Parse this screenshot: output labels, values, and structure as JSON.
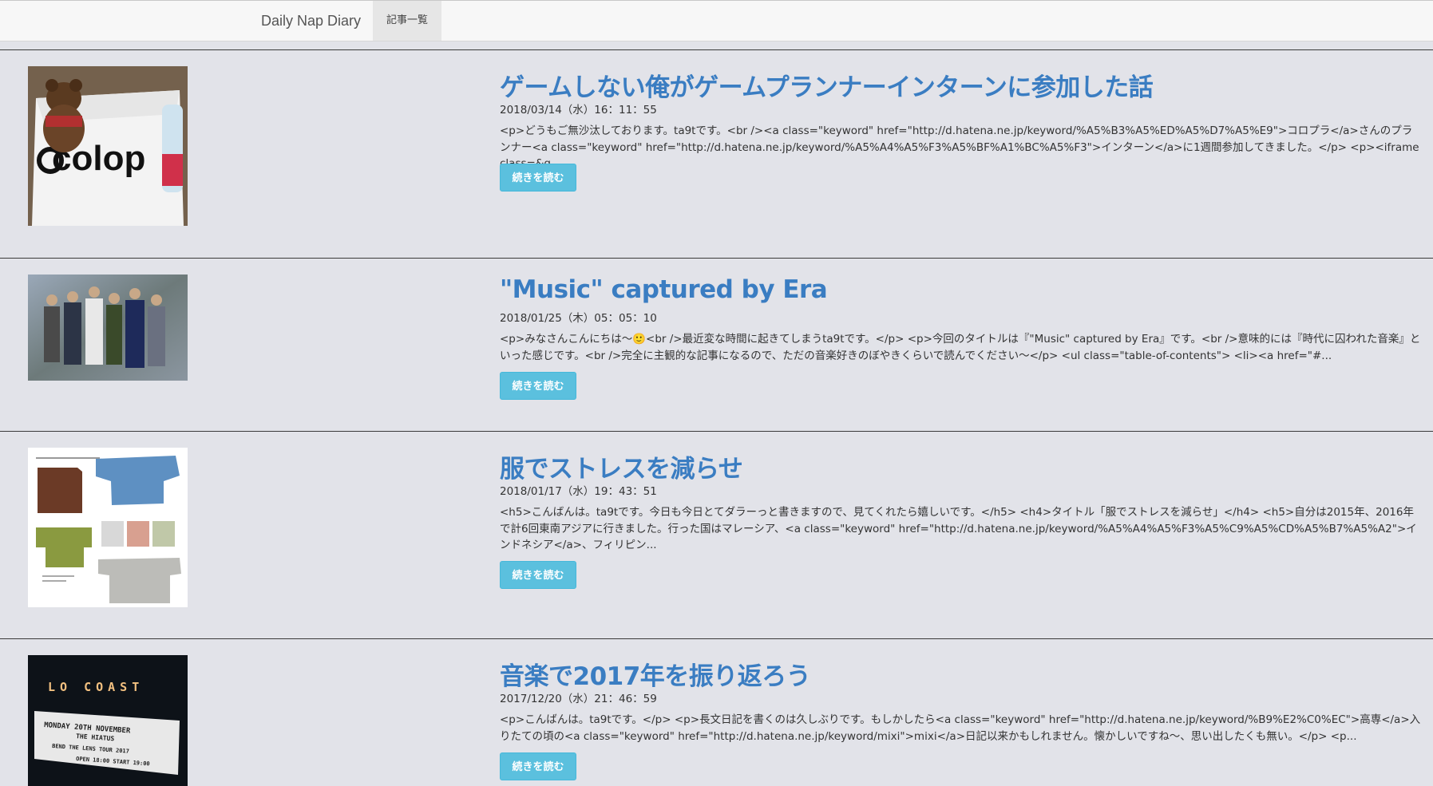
{
  "nav": {
    "brand": "Daily Nap Diary",
    "tab": "記事一覧"
  },
  "articles": [
    {
      "title": "ゲームしない俺がゲームプランナーインターンに参加した話",
      "date": "2018/03/14（水）16：11：55",
      "excerpt": "<p>どうもご無沙汰しております。ta9tです。<br /><a class=\"keyword\" href=\"http://d.hatena.ne.jp/keyword/%A5%B3%A5%ED%A5%D7%A5%E9\">コロプラ</a>さんのプランナー<a class=\"keyword\" href=\"http://d.hatena.ne.jp/keyword/%A5%A4%A5%F3%A5%BF%A1%BC%A5%F3\">インターン</a>に1週間参加してきました。</p> <p><iframe class=&q...",
      "button": "続きを読む",
      "image": "bear-tshirt-photo"
    },
    {
      "title": "\"Music\" captured by Era",
      "date": "2018/01/25（木）05：05：10",
      "excerpt": "<p>みなさんこんにちは〜🙂<br />最近変な時間に起きてしまうta9tです。</p> <p>今回のタイトルは『\"Music\" captured by Era』です。<br />意味的には『時代に囚われた音楽』といった感じです。<br />完全に主観的な記事になるので、ただの音楽好きのぼやきくらいで読んでください〜</p> <ul class=\"table-of-contents\"> <li><a href=\"#...",
      "button": "続きを読む",
      "image": "band-photo"
    },
    {
      "title": "服でストレスを減らせ",
      "date": "2018/01/17（水）19：43：51",
      "excerpt": "<h5>こんばんは。ta9tです。今日も今日とてダラーっと書きますので、見てくれたら嬉しいです。</h5> <h4>タイトル「服でストレスを減らせ」</h4> <h5>自分は2015年、2016年で計6回東南アジアに行きました。行った国はマレーシア、<a class=\"keyword\" href=\"http://d.hatena.ne.jp/keyword/%A5%A4%A5%F3%A5%C9%A5%CD%A5%B7%A5%A2\">インドネシア</a>、フィリピン...",
      "button": "続きを読む",
      "image": "clothes-catalog"
    },
    {
      "title": "音楽で2017年を振り返ろう",
      "date": "2017/12/20（水）21：46：59",
      "excerpt": "<p>こんばんは。ta9tです。</p> <p>長文日記を書くのは久しぶりです。もしかしたら<a class=\"keyword\" href=\"http://d.hatena.ne.jp/keyword/%B9%E2%C0%EC\">高専</a>入りたての頃の<a class=\"keyword\" href=\"http://d.hatena.ne.jp/keyword/mixi\">mixi</a>日記以来かもしれません。懐かしいですね〜、思い出したくも無い。</p> <p...",
      "button": "続きを読む",
      "image": "concert-marquee",
      "marquee_text": {
        "top": "LO  COAST",
        "line1": "MONDAY 20TH NOVEMBER",
        "line2": "THE HIATUS",
        "line3": "BEND THE LENS TOUR 2017",
        "line4": "OPEN 18:00    START 19:00"
      }
    }
  ]
}
